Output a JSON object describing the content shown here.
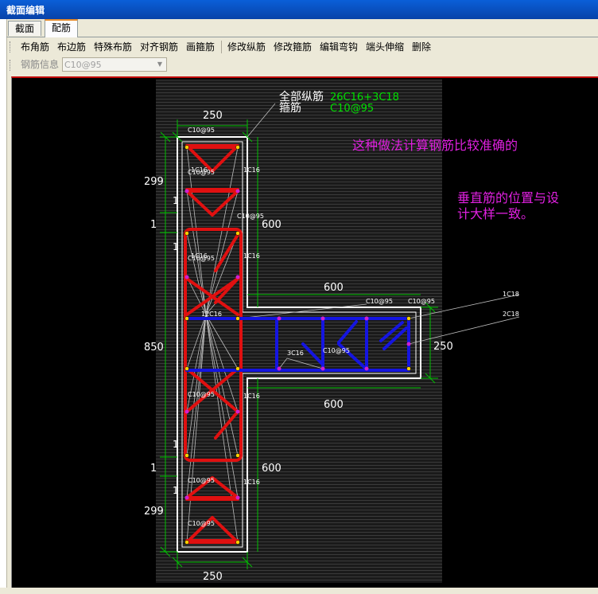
{
  "window": {
    "title": "截面编辑"
  },
  "tabs": [
    {
      "label": "截面"
    },
    {
      "label": "配筋"
    }
  ],
  "toolbar": {
    "items": [
      "布角筋",
      "布边筋",
      "特殊布筋",
      "对齐钢筋",
      "画箍筋",
      "修改纵筋",
      "修改箍筋",
      "编辑弯钩",
      "端头伸缩",
      "删除"
    ]
  },
  "rebar_info": {
    "label": "钢筋信息",
    "value": "C10@95"
  },
  "drawing": {
    "colors": {
      "background": "#000000",
      "outline": "#ffffff",
      "red_rebar": "#e01010",
      "blue_rebar": "#1515e0",
      "dim": "#00c000",
      "note": "#e020e0",
      "leader": "#c0c0c0"
    },
    "legend": {
      "all_long": "全部纵筋",
      "stirrup": "箍筋",
      "long_value": "26C16+3C18",
      "stirrup_value": "C10@95"
    },
    "notes": {
      "note1": "这种做法计算钢筋比较准确的",
      "note2_line1": "垂直筋的位置与设",
      "note2_line2": "计大样一致。"
    },
    "dims": {
      "top_width": "250",
      "bottom_width": "250",
      "left_299_top": "299",
      "left_1_top": "1",
      "left_850": "850",
      "left_1_bot": "1",
      "left_299_bot": "299",
      "right_600_top": "600",
      "right_600_bot": "600",
      "flange_600_top": "600",
      "flange_600_bot": "600",
      "flange_250": "250"
    },
    "labels": {
      "c10_1": "C10@95",
      "c10_2": "C10@95",
      "c10_3": "C10@95",
      "c10_4": "C10@95",
      "c10_5": "C10@95",
      "c10_6": "C10@95",
      "c10_7": "C10@95",
      "c10_8": "C10@95",
      "c10_9": "C10@95",
      "c10_10": "C10@95",
      "c16_1": "1C16",
      "c16_2": "1C16",
      "c16_3": "1C16",
      "c16_4": "1C16",
      "c16_5": "1C16",
      "c16_6": "1C16",
      "c16_7": "12C16",
      "c16_8": "3C16",
      "c18_1": "1C18",
      "c18_2": "2C18",
      "l1a": "1",
      "l1b": "1",
      "l1c": "1",
      "l1d": "1"
    }
  }
}
